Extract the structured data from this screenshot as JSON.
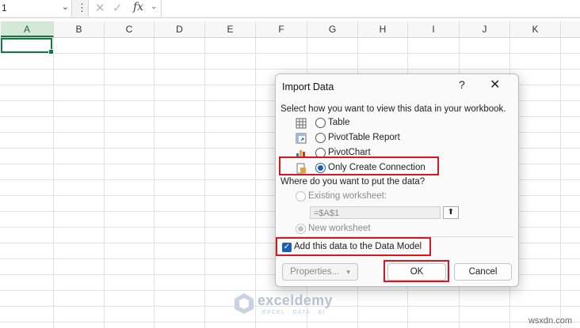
{
  "formula_bar": {
    "name_box_value": "1",
    "more_icon": "vertical-dots",
    "fx_label": "fx",
    "formula_value": ""
  },
  "columns": [
    {
      "label": "A",
      "selected": true
    },
    {
      "label": "B",
      "selected": false
    },
    {
      "label": "C",
      "selected": false
    },
    {
      "label": "D",
      "selected": false
    },
    {
      "label": "E",
      "selected": false
    },
    {
      "label": "F",
      "selected": false
    },
    {
      "label": "G",
      "selected": false
    },
    {
      "label": "H",
      "selected": false
    },
    {
      "label": "I",
      "selected": false
    },
    {
      "label": "J",
      "selected": false
    },
    {
      "label": "K",
      "selected": false
    }
  ],
  "dialog": {
    "title": "Import Data",
    "help": "?",
    "close": "✕",
    "view_prompt": "Select how you want to view this data in your workbook.",
    "view_options": [
      {
        "label": "Table",
        "icon": "table-icon",
        "checked": false
      },
      {
        "label": "PivotTable Report",
        "icon": "pivottable-icon",
        "checked": false
      },
      {
        "label": "PivotChart",
        "icon": "pivotchart-icon",
        "checked": false
      },
      {
        "label": "Only Create Connection",
        "icon": "connection-icon",
        "checked": true
      }
    ],
    "location_prompt": "Where do you want to put the data?",
    "existing_worksheet": {
      "label": "Existing worksheet:",
      "checked": false,
      "enabled": false
    },
    "reference_value": "=$A$1",
    "new_worksheet": {
      "label": "New worksheet",
      "checked": true,
      "enabled": false
    },
    "data_model": {
      "label": "Add this data to the Data Model",
      "checked": true
    },
    "properties_button": "Properties...",
    "ok_button": "OK",
    "cancel_button": "Cancel"
  },
  "watermark": {
    "name": "exceldemy",
    "tagline": "EXCEL · DATA · BI"
  },
  "site_label": "wsxdn.com",
  "colors": {
    "excel_green": "#107c41",
    "highlight_red": "#e0141e",
    "accent_blue": "#1a5fb4"
  }
}
